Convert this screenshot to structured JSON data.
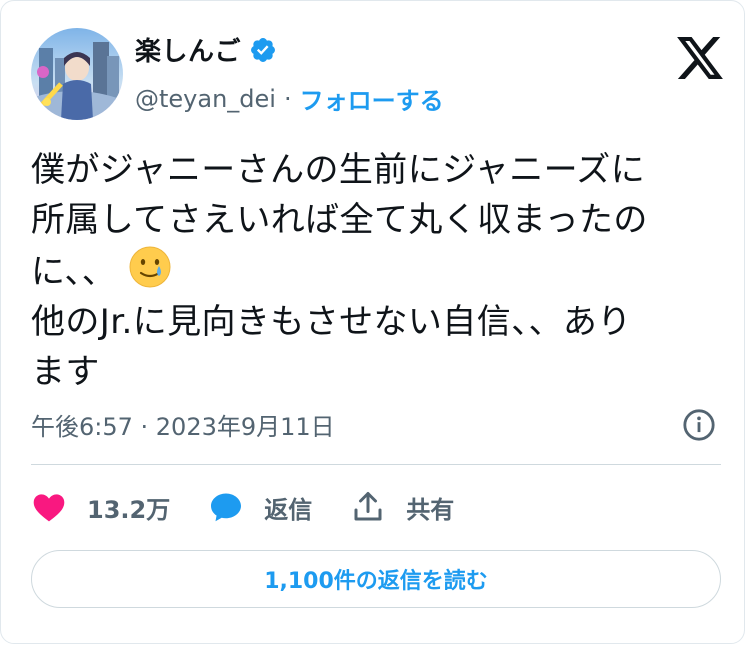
{
  "user": {
    "display_name": "楽しんご",
    "handle": "@teyan_dei",
    "separator": "·",
    "follow_label": "フォローする",
    "verified": true
  },
  "tweet": {
    "lines": [
      "僕がジャニーさんの生前にジャニーズに",
      "所属してさえいれば全て丸く収まったの",
      "に、、",
      "他のJr.に見向きもさせない自信、、あり",
      "ます"
    ],
    "emoji": "smiling-face-with-tear",
    "timestamp": "午後6:57 · 2023年9月11日"
  },
  "actions": {
    "like_count": "13.2万",
    "reply_label": "返信",
    "share_label": "共有"
  },
  "read_replies_label": "1,100件の返信を読む",
  "colors": {
    "accent": "#1d9bf0",
    "like": "#f91880",
    "text": "#0f1419",
    "secondary": "#536471"
  }
}
